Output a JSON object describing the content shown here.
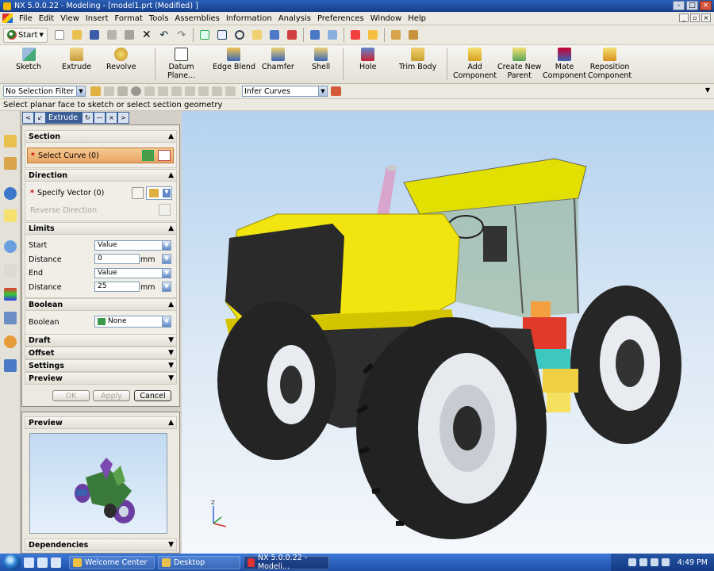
{
  "window": {
    "title": "NX 5.0.0.22 - Modeling - [model1.prt (Modified) ]"
  },
  "menu": [
    "File",
    "Edit",
    "View",
    "Insert",
    "Format",
    "Tools",
    "Assemblies",
    "Information",
    "Analysis",
    "Preferences",
    "Window",
    "Help"
  ],
  "toolbar": {
    "start_label": "Start"
  },
  "ribbon": {
    "sketch": "Sketch",
    "extrude": "Extrude",
    "revolve": "Revolve",
    "datum_plane_l1": "Datum",
    "datum_plane_l2": "Plane...",
    "edge_blend": "Edge Blend",
    "chamfer": "Chamfer",
    "shell": "Shell",
    "hole": "Hole",
    "trim_body": "Trim Body",
    "add_component_l1": "Add",
    "add_component_l2": "Component",
    "create_parent_l1": "Create New",
    "create_parent_l2": "Parent",
    "mate_component_l1": "Mate",
    "mate_component_l2": "Component",
    "reposition_l1": "Reposition",
    "reposition_l2": "Component"
  },
  "selection_bar": {
    "filter": "No Selection Filter",
    "curve_rule": "Infer Curves"
  },
  "cue_line": "Select planar face to sketch or select section geometry",
  "dialog": {
    "title": "Extrude",
    "section": {
      "header": "Section",
      "select_curve": "Select Curve (0)"
    },
    "direction": {
      "header": "Direction",
      "specify_vector": "Specify Vector (0)",
      "reverse": "Reverse Direction"
    },
    "limits": {
      "header": "Limits",
      "start_label": "Start",
      "start_value": "Value",
      "distance1_label": "Distance",
      "distance1_value": "0",
      "unit1": "mm",
      "end_label": "End",
      "end_value": "Value",
      "distance2_label": "Distance",
      "distance2_value": "25",
      "unit2": "mm"
    },
    "boolean": {
      "header": "Boolean",
      "label": "Boolean",
      "value": "None"
    },
    "collapsed_groups": [
      "Draft",
      "Offset",
      "Settings",
      "Preview"
    ],
    "buttons": {
      "ok": "OK",
      "apply": "Apply",
      "cancel": "Cancel"
    }
  },
  "preview_panel": {
    "header": "Preview",
    "footer": "Dependencies"
  },
  "viewport": {
    "axis_z": "Z"
  },
  "taskbar": {
    "tasks": [
      "Welcome Center",
      "Desktop",
      "NX 5.0.0.22 - Modeli..."
    ],
    "clock": "4:49 PM"
  },
  "colors": {
    "tractor_body": "#f2e40f",
    "tire": "#2b2b2b",
    "sky_top": "#b4d2ef",
    "dialog_bg": "#ece9e0",
    "select_highlight": "#e9a564"
  }
}
